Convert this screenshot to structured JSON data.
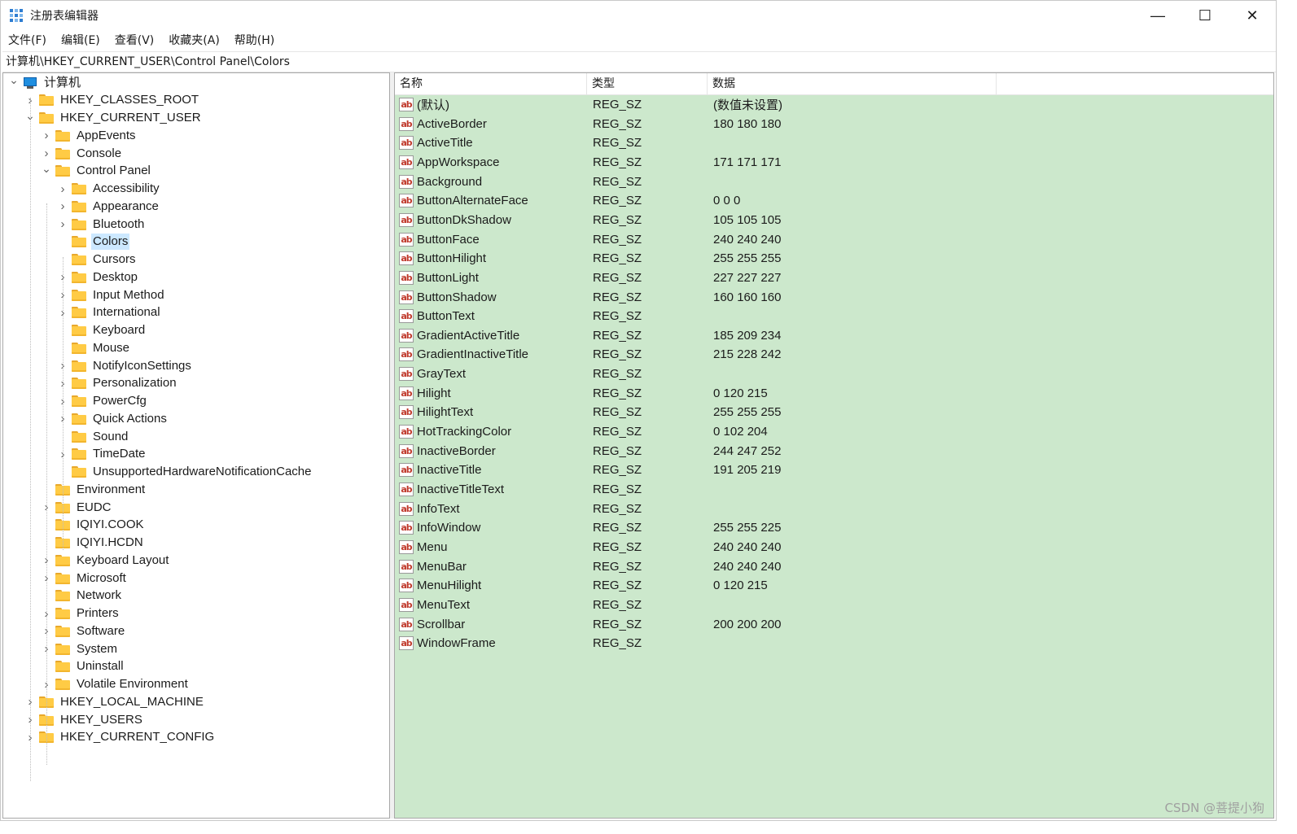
{
  "window": {
    "title": "注册表编辑器",
    "controls": {
      "minimize": "—",
      "maximize": "☐",
      "close": "✕"
    }
  },
  "menu": [
    "文件(F)",
    "编辑(E)",
    "查看(V)",
    "收藏夹(A)",
    "帮助(H)"
  ],
  "address": "计算机\\HKEY_CURRENT_USER\\Control Panel\\Colors",
  "tree": [
    {
      "label": "计算机",
      "level": 0,
      "expander": "open",
      "icon": "computer-icon"
    },
    {
      "label": "HKEY_CLASSES_ROOT",
      "level": 1,
      "expander": "closed",
      "icon": "folder-icon"
    },
    {
      "label": "HKEY_CURRENT_USER",
      "level": 1,
      "expander": "open",
      "icon": "folder-icon"
    },
    {
      "label": "AppEvents",
      "level": 2,
      "expander": "closed",
      "icon": "folder-icon"
    },
    {
      "label": "Console",
      "level": 2,
      "expander": "closed",
      "icon": "folder-icon"
    },
    {
      "label": "Control Panel",
      "level": 2,
      "expander": "open",
      "icon": "folder-icon"
    },
    {
      "label": "Accessibility",
      "level": 3,
      "expander": "closed",
      "icon": "folder-icon"
    },
    {
      "label": "Appearance",
      "level": 3,
      "expander": "closed",
      "icon": "folder-icon"
    },
    {
      "label": "Bluetooth",
      "level": 3,
      "expander": "closed",
      "icon": "folder-icon"
    },
    {
      "label": "Colors",
      "level": 3,
      "expander": "none",
      "icon": "folder-icon",
      "selected": true
    },
    {
      "label": "Cursors",
      "level": 3,
      "expander": "none",
      "icon": "folder-icon"
    },
    {
      "label": "Desktop",
      "level": 3,
      "expander": "closed",
      "icon": "folder-icon"
    },
    {
      "label": "Input Method",
      "level": 3,
      "expander": "closed",
      "icon": "folder-icon"
    },
    {
      "label": "International",
      "level": 3,
      "expander": "closed",
      "icon": "folder-icon"
    },
    {
      "label": "Keyboard",
      "level": 3,
      "expander": "none",
      "icon": "folder-icon"
    },
    {
      "label": "Mouse",
      "level": 3,
      "expander": "none",
      "icon": "folder-icon"
    },
    {
      "label": "NotifyIconSettings",
      "level": 3,
      "expander": "closed",
      "icon": "folder-icon"
    },
    {
      "label": "Personalization",
      "level": 3,
      "expander": "closed",
      "icon": "folder-icon"
    },
    {
      "label": "PowerCfg",
      "level": 3,
      "expander": "closed",
      "icon": "folder-icon"
    },
    {
      "label": "Quick Actions",
      "level": 3,
      "expander": "closed",
      "icon": "folder-icon"
    },
    {
      "label": "Sound",
      "level": 3,
      "expander": "none",
      "icon": "folder-icon"
    },
    {
      "label": "TimeDate",
      "level": 3,
      "expander": "closed",
      "icon": "folder-icon"
    },
    {
      "label": "UnsupportedHardwareNotificationCache",
      "level": 3,
      "expander": "none",
      "icon": "folder-icon"
    },
    {
      "label": "Environment",
      "level": 2,
      "expander": "none",
      "icon": "folder-icon"
    },
    {
      "label": "EUDC",
      "level": 2,
      "expander": "closed",
      "icon": "folder-icon"
    },
    {
      "label": "IQIYI.COOK",
      "level": 2,
      "expander": "none",
      "icon": "folder-icon"
    },
    {
      "label": "IQIYI.HCDN",
      "level": 2,
      "expander": "none",
      "icon": "folder-icon"
    },
    {
      "label": "Keyboard Layout",
      "level": 2,
      "expander": "closed",
      "icon": "folder-icon"
    },
    {
      "label": "Microsoft",
      "level": 2,
      "expander": "closed",
      "icon": "folder-icon"
    },
    {
      "label": "Network",
      "level": 2,
      "expander": "none",
      "icon": "folder-icon"
    },
    {
      "label": "Printers",
      "level": 2,
      "expander": "closed",
      "icon": "folder-icon"
    },
    {
      "label": "Software",
      "level": 2,
      "expander": "closed",
      "icon": "folder-icon"
    },
    {
      "label": "System",
      "level": 2,
      "expander": "closed",
      "icon": "folder-icon"
    },
    {
      "label": "Uninstall",
      "level": 2,
      "expander": "none",
      "icon": "folder-icon"
    },
    {
      "label": "Volatile Environment",
      "level": 2,
      "expander": "closed",
      "icon": "folder-icon"
    },
    {
      "label": "HKEY_LOCAL_MACHINE",
      "level": 1,
      "expander": "closed",
      "icon": "folder-icon"
    },
    {
      "label": "HKEY_USERS",
      "level": 1,
      "expander": "closed",
      "icon": "folder-icon"
    },
    {
      "label": "HKEY_CURRENT_CONFIG",
      "level": 1,
      "expander": "closed",
      "icon": "folder-icon"
    }
  ],
  "list": {
    "columns": [
      "名称",
      "类型",
      "数据"
    ],
    "rows": [
      {
        "name": "(默认)",
        "type": "REG_SZ",
        "data": "(数值未设置)"
      },
      {
        "name": "ActiveBorder",
        "type": "REG_SZ",
        "data": "180 180 180"
      },
      {
        "name": "ActiveTitle",
        "type": "REG_SZ",
        "data": ""
      },
      {
        "name": "AppWorkspace",
        "type": "REG_SZ",
        "data": "171 171 171"
      },
      {
        "name": "Background",
        "type": "REG_SZ",
        "data": ""
      },
      {
        "name": "ButtonAlternateFace",
        "type": "REG_SZ",
        "data": "0 0 0"
      },
      {
        "name": "ButtonDkShadow",
        "type": "REG_SZ",
        "data": "105 105 105"
      },
      {
        "name": "ButtonFace",
        "type": "REG_SZ",
        "data": "240 240 240"
      },
      {
        "name": "ButtonHilight",
        "type": "REG_SZ",
        "data": "255 255 255"
      },
      {
        "name": "ButtonLight",
        "type": "REG_SZ",
        "data": "227 227 227"
      },
      {
        "name": "ButtonShadow",
        "type": "REG_SZ",
        "data": "160 160 160"
      },
      {
        "name": "ButtonText",
        "type": "REG_SZ",
        "data": ""
      },
      {
        "name": "GradientActiveTitle",
        "type": "REG_SZ",
        "data": "185 209 234"
      },
      {
        "name": "GradientInactiveTitle",
        "type": "REG_SZ",
        "data": "215 228 242"
      },
      {
        "name": "GrayText",
        "type": "REG_SZ",
        "data": ""
      },
      {
        "name": "Hilight",
        "type": "REG_SZ",
        "data": "0 120 215"
      },
      {
        "name": "HilightText",
        "type": "REG_SZ",
        "data": "255 255 255"
      },
      {
        "name": "HotTrackingColor",
        "type": "REG_SZ",
        "data": "0 102 204"
      },
      {
        "name": "InactiveBorder",
        "type": "REG_SZ",
        "data": "244 247 252"
      },
      {
        "name": "InactiveTitle",
        "type": "REG_SZ",
        "data": "191 205 219"
      },
      {
        "name": "InactiveTitleText",
        "type": "REG_SZ",
        "data": ""
      },
      {
        "name": "InfoText",
        "type": "REG_SZ",
        "data": ""
      },
      {
        "name": "InfoWindow",
        "type": "REG_SZ",
        "data": "255 255 225"
      },
      {
        "name": "Menu",
        "type": "REG_SZ",
        "data": "240 240 240"
      },
      {
        "name": "MenuBar",
        "type": "REG_SZ",
        "data": "240 240 240"
      },
      {
        "name": "MenuHilight",
        "type": "REG_SZ",
        "data": "0 120 215"
      },
      {
        "name": "MenuText",
        "type": "REG_SZ",
        "data": ""
      },
      {
        "name": "Scrollbar",
        "type": "REG_SZ",
        "data": "200 200 200"
      },
      {
        "name": "WindowFrame",
        "type": "REG_SZ",
        "data": ""
      }
    ]
  },
  "watermark": "CSDN @菩提小狗",
  "colors": {
    "list_background": "#cce8cc",
    "selection": "#cce8ff",
    "folder": "#ffcb45"
  }
}
